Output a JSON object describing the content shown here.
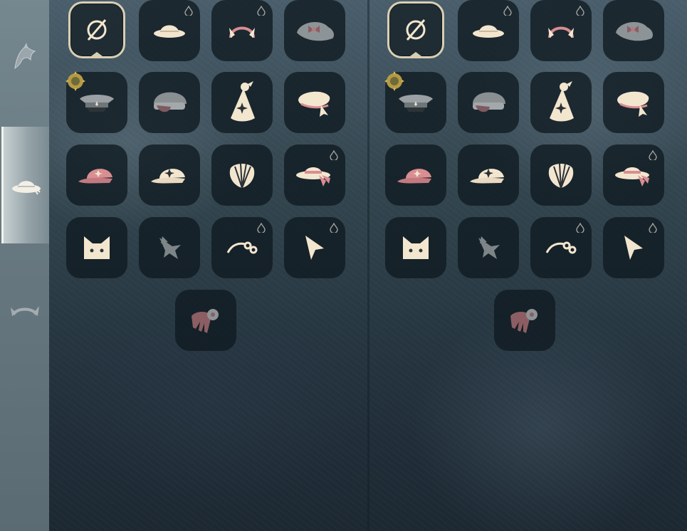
{
  "sidebar": {
    "tabs": [
      {
        "name": "hair-tab",
        "icon": "hair-icon",
        "active": false
      },
      {
        "name": "hat-tab",
        "icon": "hat-icon",
        "active": true
      },
      {
        "name": "horns-tab",
        "icon": "horns-icon",
        "active": false
      }
    ]
  },
  "panels": [
    {
      "name": "left"
    },
    {
      "name": "right"
    }
  ],
  "items": [
    {
      "icon": "none-icon",
      "selected": true,
      "drop": false,
      "badge": false
    },
    {
      "icon": "sun-hat-icon",
      "drop": true
    },
    {
      "icon": "headband-icon",
      "drop": true
    },
    {
      "icon": "bow-bonnet-icon",
      "drop": false
    },
    {
      "icon": "captain-cap-icon",
      "drop": false,
      "badge": true
    },
    {
      "icon": "beanie-icon",
      "drop": false
    },
    {
      "icon": "party-hat-icon",
      "drop": false
    },
    {
      "icon": "beret-icon",
      "drop": false
    },
    {
      "icon": "baseball-cap-icon",
      "drop": false
    },
    {
      "icon": "star-cap-icon",
      "drop": false
    },
    {
      "icon": "shell-icon",
      "drop": false
    },
    {
      "icon": "ribbon-hat-icon",
      "drop": true
    },
    {
      "icon": "cat-ears-icon",
      "drop": false
    },
    {
      "icon": "bird-icon",
      "drop": false
    },
    {
      "icon": "flower-clip-icon",
      "drop": true
    },
    {
      "icon": "pointer-icon",
      "drop": true
    },
    {
      "icon": "flower-comb-icon",
      "drop": false
    }
  ],
  "colors": {
    "cream": "#f3e6cf",
    "pink": "#d98e92",
    "mauve": "#8c5e63",
    "gray": "#8d9497",
    "selected_border": "#d8cfb3"
  }
}
